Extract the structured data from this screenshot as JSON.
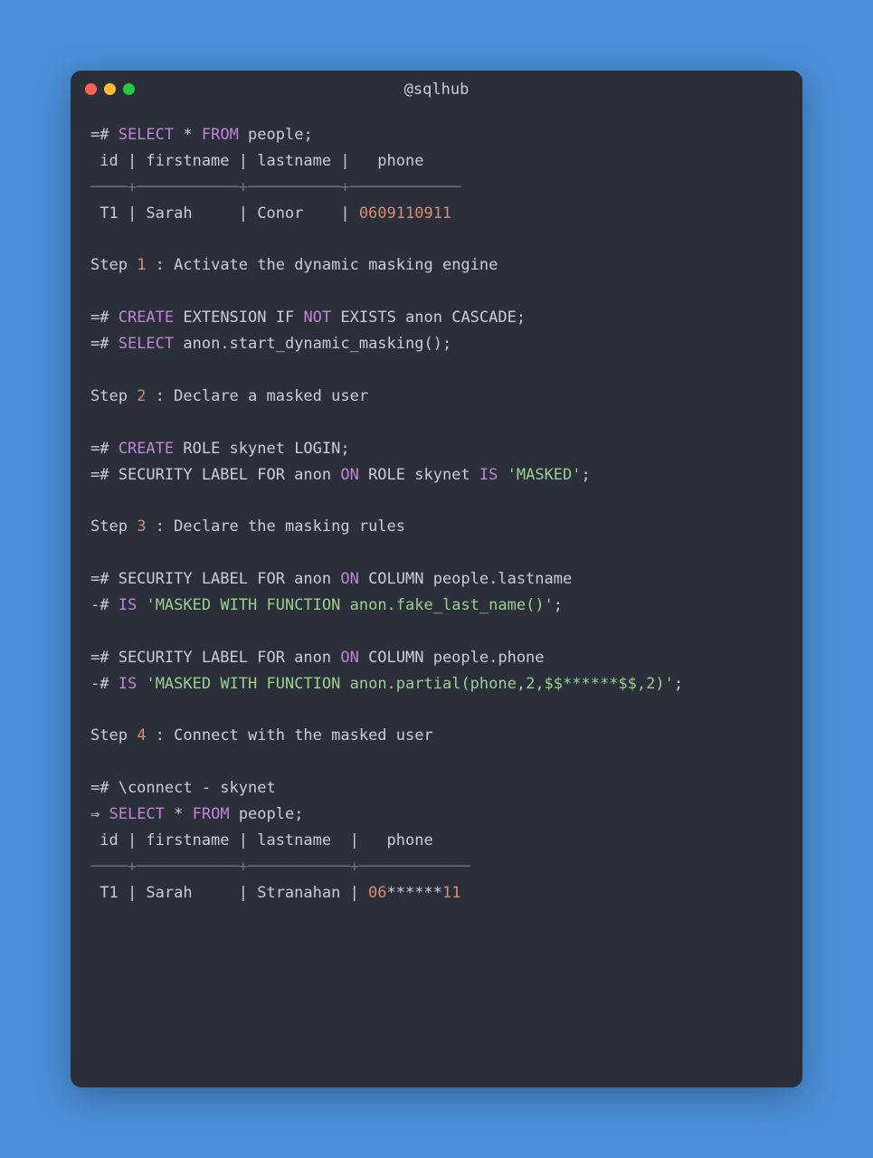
{
  "title": "@sqlhub",
  "lines": [
    [
      [
        "",
        "=# "
      ],
      [
        "kw",
        "SELECT"
      ],
      [
        "",
        " * "
      ],
      [
        "kw",
        "FROM"
      ],
      [
        "",
        " people;"
      ]
    ],
    [
      [
        "",
        " id | firstname | lastname |   phone"
      ]
    ],
    [
      [
        "dim",
        "────+───────────+──────────+────────────"
      ]
    ],
    [
      [
        "",
        " T1 | Sarah     | Conor    | "
      ],
      [
        "num",
        "0609110911"
      ]
    ],
    [
      [
        "",
        ""
      ]
    ],
    [
      [
        "",
        "Step "
      ],
      [
        "num",
        "1"
      ],
      [
        "",
        " : Activate the dynamic masking engine"
      ]
    ],
    [
      [
        "",
        ""
      ]
    ],
    [
      [
        "",
        "=# "
      ],
      [
        "kw",
        "CREATE"
      ],
      [
        "",
        " EXTENSION IF "
      ],
      [
        "kw",
        "NOT"
      ],
      [
        "",
        " EXISTS anon CASCADE;"
      ]
    ],
    [
      [
        "",
        "=# "
      ],
      [
        "kw",
        "SELECT"
      ],
      [
        "",
        " anon.start_dynamic_masking();"
      ]
    ],
    [
      [
        "",
        ""
      ]
    ],
    [
      [
        "",
        "Step "
      ],
      [
        "num",
        "2"
      ],
      [
        "",
        " : Declare a masked user"
      ]
    ],
    [
      [
        "",
        ""
      ]
    ],
    [
      [
        "",
        "=# "
      ],
      [
        "kw",
        "CREATE"
      ],
      [
        "",
        " ROLE skynet LOGIN;"
      ]
    ],
    [
      [
        "",
        "=# SECURITY LABEL FOR anon "
      ],
      [
        "kw",
        "ON"
      ],
      [
        "",
        " ROLE skynet "
      ],
      [
        "kw",
        "IS"
      ],
      [
        "",
        " "
      ],
      [
        "str",
        "'MASKED'"
      ],
      [
        "",
        ";"
      ]
    ],
    [
      [
        "",
        ""
      ]
    ],
    [
      [
        "",
        "Step "
      ],
      [
        "num",
        "3"
      ],
      [
        "",
        " : Declare the masking rules"
      ]
    ],
    [
      [
        "",
        ""
      ]
    ],
    [
      [
        "",
        "=# SECURITY LABEL FOR anon "
      ],
      [
        "kw",
        "ON"
      ],
      [
        "",
        " COLUMN people.lastname"
      ]
    ],
    [
      [
        "",
        "-# "
      ],
      [
        "kw",
        "IS"
      ],
      [
        "",
        " "
      ],
      [
        "str",
        "'MASKED WITH FUNCTION anon.fake_last_name()'"
      ],
      [
        "",
        ";"
      ]
    ],
    [
      [
        "",
        ""
      ]
    ],
    [
      [
        "",
        "=# SECURITY LABEL FOR anon "
      ],
      [
        "kw",
        "ON"
      ],
      [
        "",
        " COLUMN people.phone"
      ]
    ],
    [
      [
        "",
        "-# "
      ],
      [
        "kw",
        "IS"
      ],
      [
        "",
        " "
      ],
      [
        "str",
        "'MASKED WITH FUNCTION anon.partial(phone,2,$$******$$,2)'"
      ],
      [
        "",
        ";"
      ]
    ],
    [
      [
        "",
        ""
      ]
    ],
    [
      [
        "",
        "Step "
      ],
      [
        "num",
        "4"
      ],
      [
        "",
        " : Connect with the masked user"
      ]
    ],
    [
      [
        "",
        ""
      ]
    ],
    [
      [
        "",
        "=# \\connect - skynet"
      ]
    ],
    [
      [
        "",
        "⇒ "
      ],
      [
        "kw",
        "SELECT"
      ],
      [
        "",
        " * "
      ],
      [
        "kw",
        "FROM"
      ],
      [
        "",
        " people;"
      ]
    ],
    [
      [
        "",
        " id | firstname | lastname  |   phone"
      ]
    ],
    [
      [
        "dim",
        "────+───────────+───────────+────────────"
      ]
    ],
    [
      [
        "",
        " T1 | Sarah     | Stranahan | "
      ],
      [
        "num",
        "06"
      ],
      [
        "",
        "******"
      ],
      [
        "num",
        "11"
      ]
    ]
  ]
}
